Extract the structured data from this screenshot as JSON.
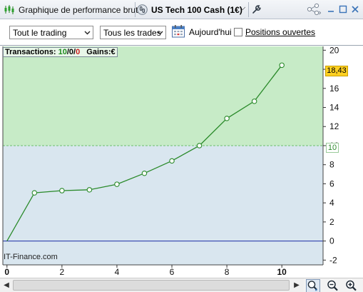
{
  "window": {
    "title": "Graphique de performance brute",
    "instrument": "US Tech 100 Cash (1€)"
  },
  "toolbar": {
    "period_select": {
      "value": "Tout le trading"
    },
    "trades_select": {
      "value": "Tous les trades"
    },
    "today_label": "Aujourd'hui",
    "open_positions_label": "Positions ouvertes",
    "open_positions_checked": false
  },
  "summary": {
    "label": "Transactions:",
    "winning": "10",
    "sep1": "/",
    "neutral": "0",
    "sep2": "/",
    "losing": "0",
    "gains_label": "Gains:",
    "gains_value": "€"
  },
  "watermark": "IT-Finance.com",
  "colors": {
    "positive_zone": "#c7ebc7",
    "negative_zone": "#d9e6ef",
    "line": "#2a8a2a",
    "zero_line": "#1c2fa6",
    "badge": "#ffd021"
  },
  "icons": {
    "chart": "candlestick-icon",
    "instrument": "link-icon",
    "settings": "wrench-icon",
    "share": "share-icon",
    "minimize": "minimize-icon",
    "maximize": "maximize-icon",
    "close": "close-icon",
    "calendar": "calendar-icon",
    "zoom_reset": "zoom-reset-icon",
    "zoom_out": "zoom-out-icon",
    "zoom_in": "zoom-in-icon"
  },
  "chart_data": {
    "type": "line",
    "x": [
      0,
      1,
      2,
      3,
      4,
      5,
      6,
      7,
      8,
      9,
      10
    ],
    "values": [
      0,
      5.05,
      5.28,
      5.37,
      5.95,
      7.1,
      8.4,
      10.0,
      12.85,
      14.65,
      18.43
    ],
    "xticks": [
      0,
      2,
      4,
      6,
      8,
      10
    ],
    "yticks": [
      -2,
      0,
      2,
      4,
      6,
      8,
      10,
      12,
      14,
      16,
      18,
      20
    ],
    "xlim": [
      -0.15,
      11.5
    ],
    "ylim": [
      -2.5,
      20.4
    ],
    "threshold": 10,
    "threshold_label": "10",
    "last_value_label": "18,43",
    "grid": false,
    "xlabel": "",
    "ylabel": ""
  }
}
